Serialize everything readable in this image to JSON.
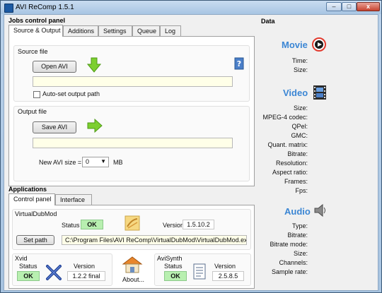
{
  "window": {
    "title": "AVI ReComp  1.5.1",
    "min_label": "–",
    "max_label": "□",
    "close_label": "x"
  },
  "jobs": {
    "title": "Jobs control panel",
    "tabs": [
      "Source & Output",
      "Additions",
      "Settings",
      "Queue",
      "Log"
    ],
    "source": {
      "label": "Source file",
      "open_button": "Open AVI",
      "path_value": "",
      "autoset_label": "Auto-set output path",
      "autoset_checked": false
    },
    "output": {
      "label": "Output file",
      "save_button": "Save AVI",
      "path_value": "",
      "size_label": "New AVI size =",
      "size_value": "0",
      "size_unit": "MB"
    }
  },
  "applications": {
    "title": "Applications",
    "tabs": [
      "Control panel",
      "Interface"
    ],
    "virtualdubmod": {
      "title": "VirtualDubMod",
      "status_label": "Status",
      "status_value": "OK",
      "version_label": "Version",
      "version_value": "1.5.10.2",
      "set_path_button": "Set path",
      "path_value": "C:\\Program Files\\AVI ReComp\\VirtualDubMod\\VirtualDubMod.exe"
    },
    "xvid": {
      "title": "Xvid",
      "status_label": "Status",
      "status_value": "OK",
      "version_label": "Version",
      "version_value": "1.2.2 final"
    },
    "about": {
      "label": "About..."
    },
    "avisynth": {
      "title": "AviSynth",
      "status_label": "Status",
      "status_value": "OK",
      "version_label": "Version",
      "version_value": "2.5.8.5"
    }
  },
  "data": {
    "title": "Data",
    "movie": {
      "heading": "Movie",
      "fields": [
        "Time:",
        "Size:"
      ]
    },
    "video": {
      "heading": "Video",
      "fields": [
        "Size:",
        "MPEG-4 codec:",
        "QPel:",
        "GMC:",
        "Quant. matrix:",
        "Bitrate:",
        "Resolution:",
        "Aspect ratio:",
        "Frames:",
        "Fps:"
      ]
    },
    "audio": {
      "heading": "Audio",
      "fields": [
        "Type:",
        "Bitrate:",
        "Bitrate mode:",
        "Size:",
        "Channels:",
        "Sample rate:"
      ]
    }
  },
  "colors": {
    "accent": "#3b86d4",
    "ok_bg": "#b8efb0",
    "field_bg": "#ffffe8"
  }
}
